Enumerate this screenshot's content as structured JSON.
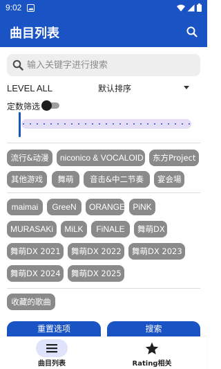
{
  "status_bar": {
    "time": "9:02"
  },
  "app_bar": {
    "title": "曲目列表"
  },
  "search": {
    "placeholder": "输入关键字进行搜索"
  },
  "filters": {
    "level_label": "LEVEL ALL",
    "sort_label": "默认排序",
    "constant_filter_label": "定数筛选",
    "constant_filter_enabled": false
  },
  "genre_chips": [
    "流行&动漫",
    "niconico & VOCALOID",
    "东方Project",
    "其他游戏",
    "舞萌",
    "音击&中二节奏",
    "宴会場"
  ],
  "version_chips": [
    "maimai",
    "GreeN",
    "ORANGE",
    "PiNK",
    "MURASAKi",
    "MiLK",
    "FiNALE",
    "舞萌DX",
    "舞萌DX 2021",
    "舞萌DX 2022",
    "舞萌DX 2023",
    "舞萌DX 2024",
    "舞萌DX 2025"
  ],
  "favorites_chip": "收藏的歌曲",
  "actions": {
    "reset_label": "重置选项",
    "search_label": "搜索"
  },
  "bottom_nav": [
    {
      "label": "曲目列表",
      "icon": "menu-icon",
      "active": true
    },
    {
      "label": "Rating相关",
      "icon": "star-icon",
      "active": false
    }
  ],
  "colors": {
    "primary": "#1a53c4",
    "chip": "#8a8a8a",
    "slider_track": "#e4ddf5"
  }
}
